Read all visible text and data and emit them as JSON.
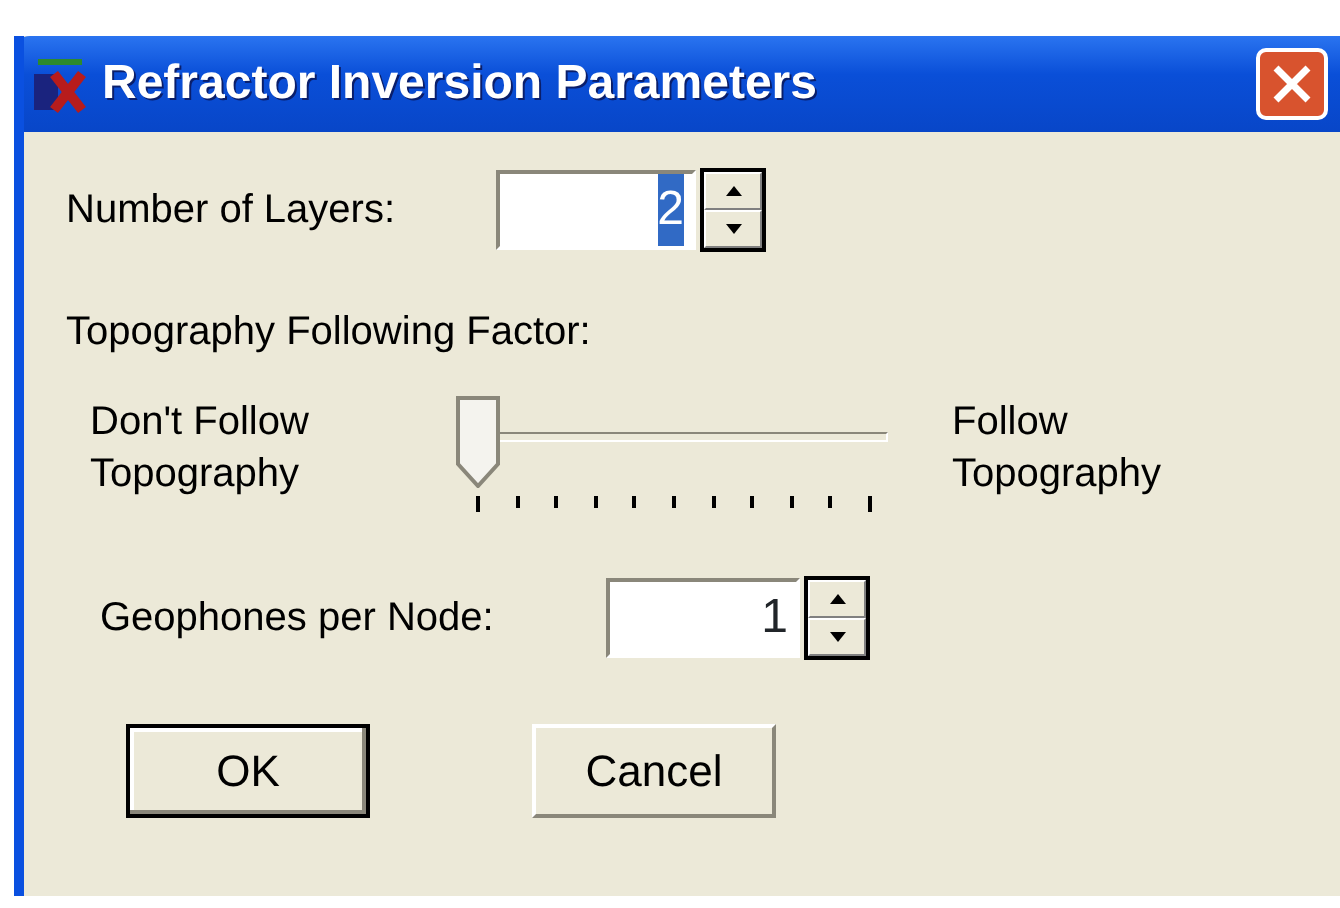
{
  "window": {
    "title": "Refractor Inversion Parameters"
  },
  "layers": {
    "label": "Number of Layers:",
    "value": "2",
    "value_selected": true
  },
  "topography": {
    "label": "Topography Following Factor:",
    "min_label": "Don't Follow Topography",
    "max_label": "Follow Topography",
    "level": 0
  },
  "geophones": {
    "label": "Geophones per Node:",
    "value": "1",
    "value_selected": false
  },
  "buttons": [
    {
      "label": "OK",
      "default": true
    },
    {
      "label": "Cancel",
      "default": false
    }
  ]
}
